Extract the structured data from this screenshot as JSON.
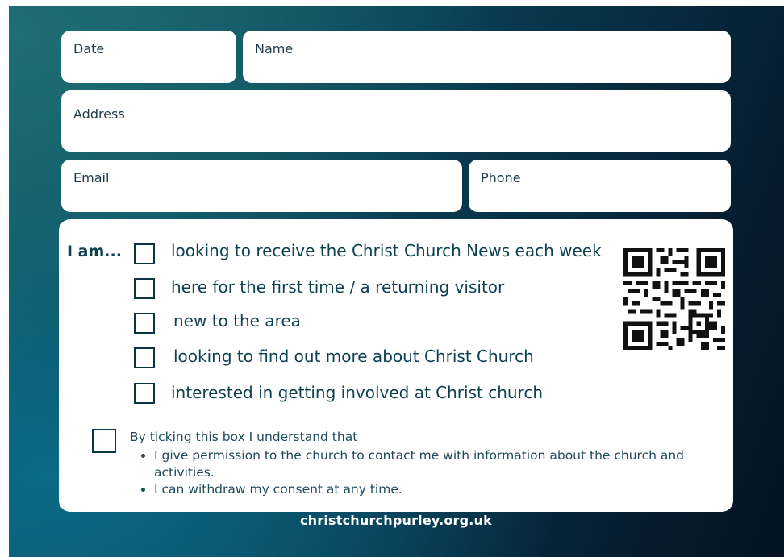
{
  "fields": {
    "date_label": "Date",
    "name_label": "Name",
    "address_label": "Address",
    "email_label": "Email",
    "phone_label": "Phone"
  },
  "panel": {
    "intro": "I am...",
    "options": [
      "looking to receive the Christ Church News each week",
      "here for the first time / a returning visitor",
      "new to the area",
      "looking to find out more about Christ Church",
      "interested in getting involved at Christ church"
    ]
  },
  "consent": {
    "heading": "By ticking this box I understand that",
    "points": [
      "I give permission to the church to contact me with information about the church and activities.",
      "I can withdraw my consent at any time."
    ]
  },
  "footer": {
    "website": "christchurchpurley.org.uk"
  },
  "colors": {
    "text": "#0d4152",
    "background_dark": "#061f33",
    "background_teal": "#0e5a6a"
  },
  "icons": {
    "qr": "qr-code-icon"
  }
}
